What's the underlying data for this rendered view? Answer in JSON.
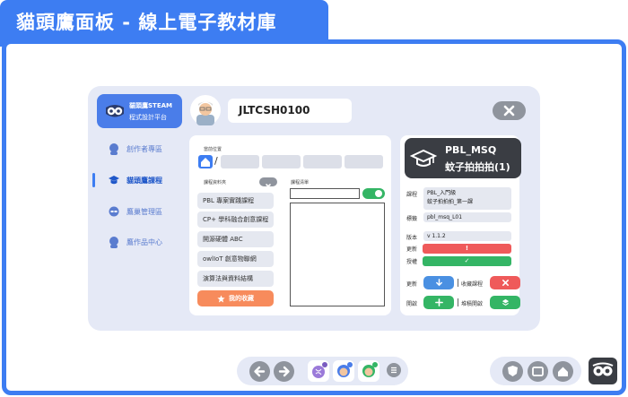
{
  "header": {
    "title": "貓頭鷹面板 - 線上電子教材庫"
  },
  "brand": {
    "line1": "貓頭鷹STEAM",
    "line2": "程式設計平台"
  },
  "user": {
    "id": "JLTCSH0100"
  },
  "sidebar": {
    "items": [
      {
        "label": "創作者專區",
        "active": false
      },
      {
        "label": "貓頭鷹課程",
        "active": true
      },
      {
        "label": "鷹巢管理區",
        "active": false
      },
      {
        "label": "鷹作品中心",
        "active": false
      }
    ]
  },
  "middle": {
    "location_label": "當前位置",
    "category_label": "課程資料夾",
    "list_label": "課程清單",
    "categories": [
      "PBL 專案實踐課程",
      "CP+ 學科融合創意課程",
      "開源硬體 ABC",
      "owlIoT 創意物聯網",
      "演算法與資料結構"
    ],
    "favorite_label": "我的收藏"
  },
  "course": {
    "code": "PBL_MSQ",
    "name": "蚊子拍拍拍(1)",
    "course_label": "課程",
    "course_value_1": "PBL_入門級",
    "course_value_2": "蚊子拍拍拍_第一課",
    "tag_label": "標籤",
    "tag_value": "pbl_msq_L01",
    "version_label": "版本",
    "version_value": "v 1.1.2",
    "update_label": "更新",
    "update_mark": "!",
    "auth_label": "授權",
    "auth_mark": "✓",
    "action_update_label": "更新",
    "action_fav_label": "收藏課程",
    "action_open_label": "開啟",
    "action_stack_label": "堆積開啟"
  },
  "colors": {
    "primary": "#3d7df2",
    "red": "#ef5a5a",
    "green": "#34b565",
    "blue": "#4a90e2",
    "orange": "#f78b5c",
    "dark": "#3a3d43",
    "panel": "#e5e9f6"
  }
}
